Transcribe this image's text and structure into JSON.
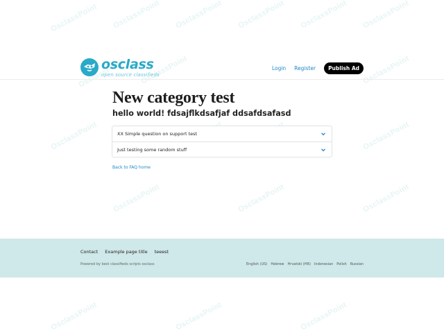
{
  "header": {
    "logo": {
      "name": "osclass",
      "tagline": "open source classifieds"
    },
    "nav": {
      "login": "Login",
      "register": "Register",
      "publish": "Publish Ad"
    }
  },
  "main": {
    "title": "New category test",
    "subtitle": "hello world! fdsajflkdsafjaf ddsafdsafasd",
    "faq": [
      {
        "question": "XX Simple question on support test",
        "icon": "chevron-down-icon"
      },
      {
        "question": "Just testing some random stuff",
        "icon": "chevron-down-icon"
      }
    ],
    "back_link": "Back to FAQ home"
  },
  "footer": {
    "links": [
      "Contact",
      "Example page title",
      "teeest"
    ],
    "powered": "Powered by best classifieds scripts osclass",
    "languages": [
      "English (US)",
      "Hebrew",
      "Hrvatski (HR)",
      "Indonesian",
      "Polish",
      "Russian"
    ]
  },
  "colors": {
    "brand": "#2aa9c9",
    "link": "#1e88c7",
    "footer_bg": "#cfe8e9",
    "publish_bg": "#000000"
  }
}
